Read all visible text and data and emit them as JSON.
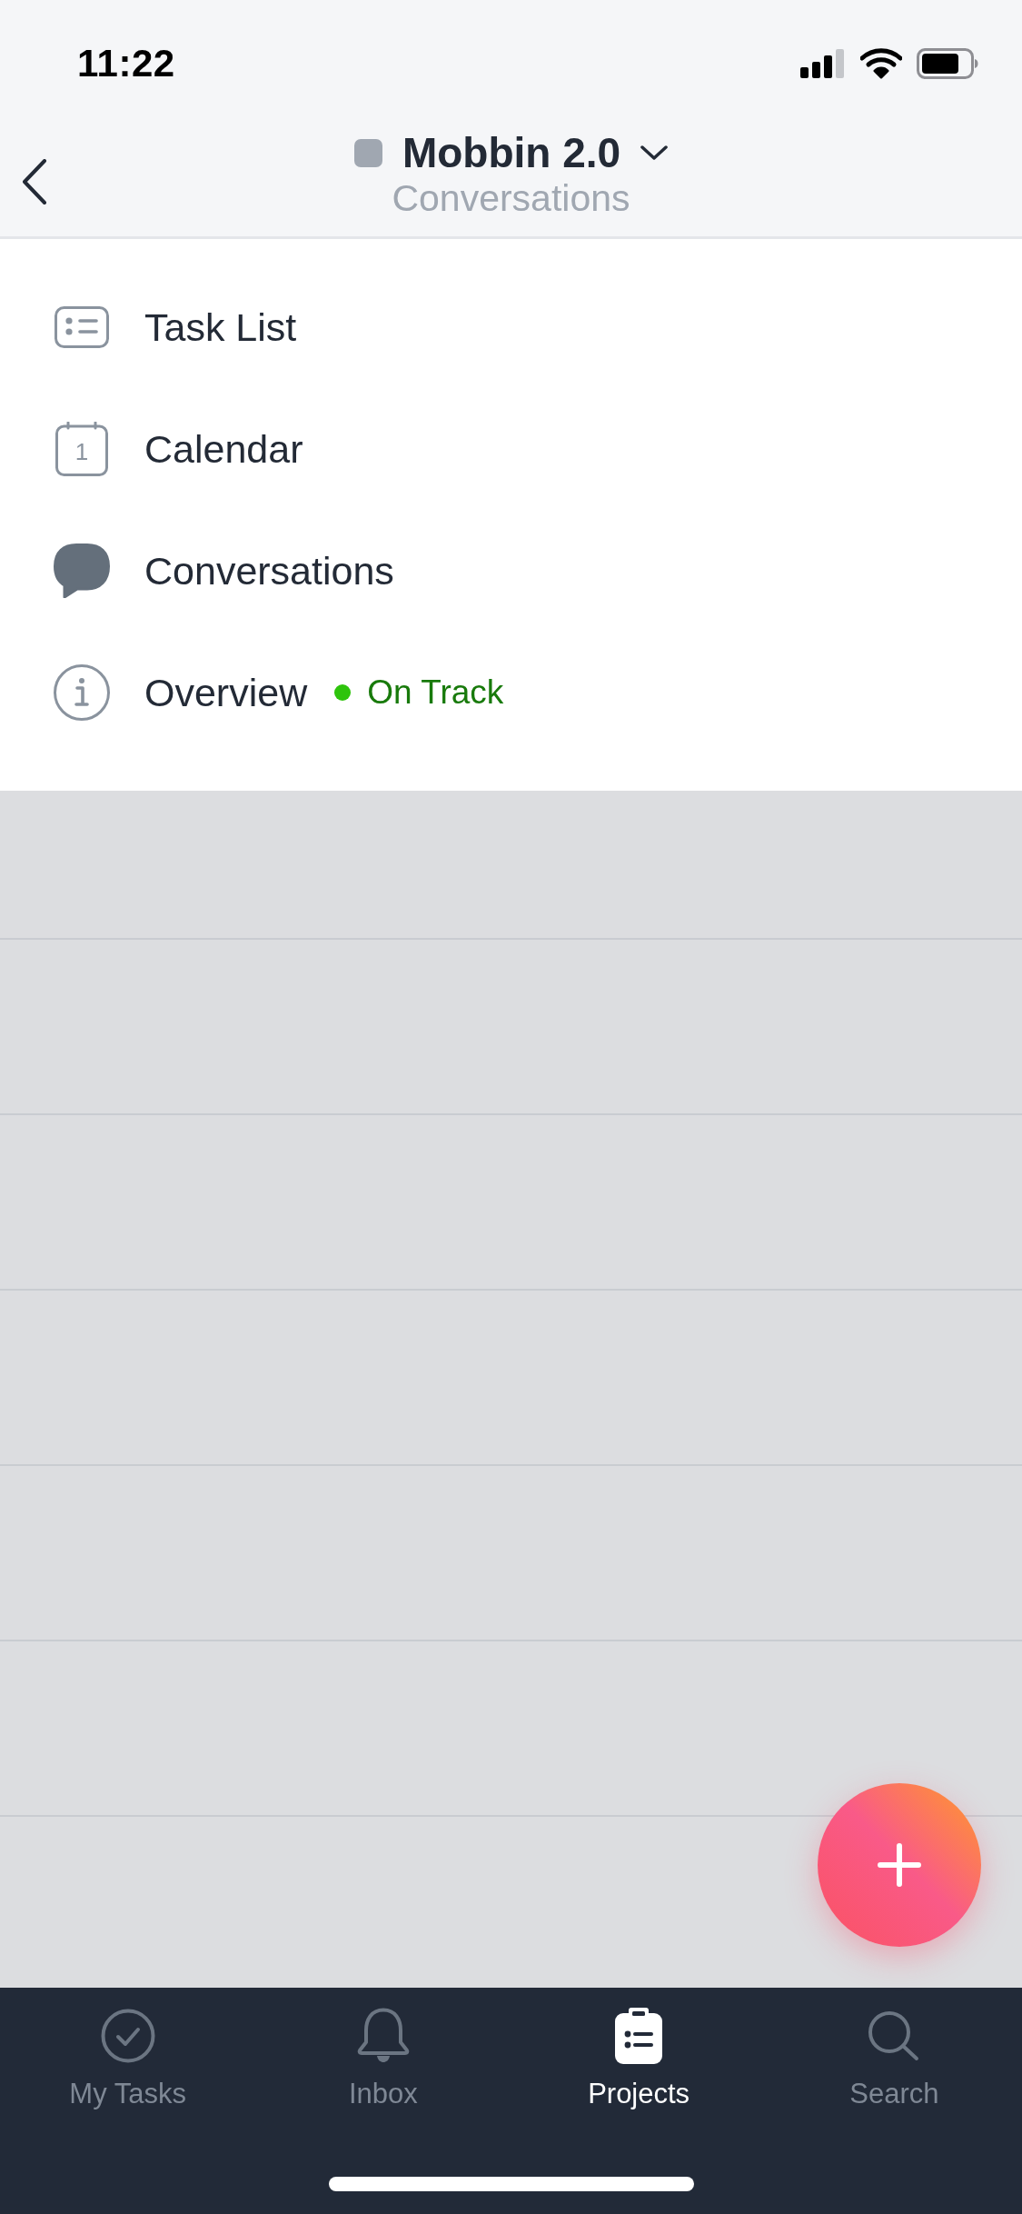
{
  "status_bar": {
    "time": "11:22"
  },
  "header": {
    "title": "Mobbin 2.0",
    "subtitle": "Conversations"
  },
  "menu": [
    {
      "kind": "task_list",
      "label": "Task List",
      "selected": false
    },
    {
      "kind": "calendar",
      "label": "Calendar",
      "icon_text": "1",
      "selected": false
    },
    {
      "kind": "conversations",
      "label": "Conversations",
      "selected": true
    },
    {
      "kind": "overview",
      "label": "Overview",
      "selected": false,
      "status": {
        "text": "On Track",
        "color": "#2ec40c"
      }
    }
  ],
  "tabs": [
    {
      "kind": "my_tasks",
      "label": "My Tasks",
      "selected": false
    },
    {
      "kind": "inbox",
      "label": "Inbox",
      "selected": false
    },
    {
      "kind": "projects",
      "label": "Projects",
      "selected": true
    },
    {
      "kind": "search",
      "label": "Search",
      "selected": false
    }
  ]
}
